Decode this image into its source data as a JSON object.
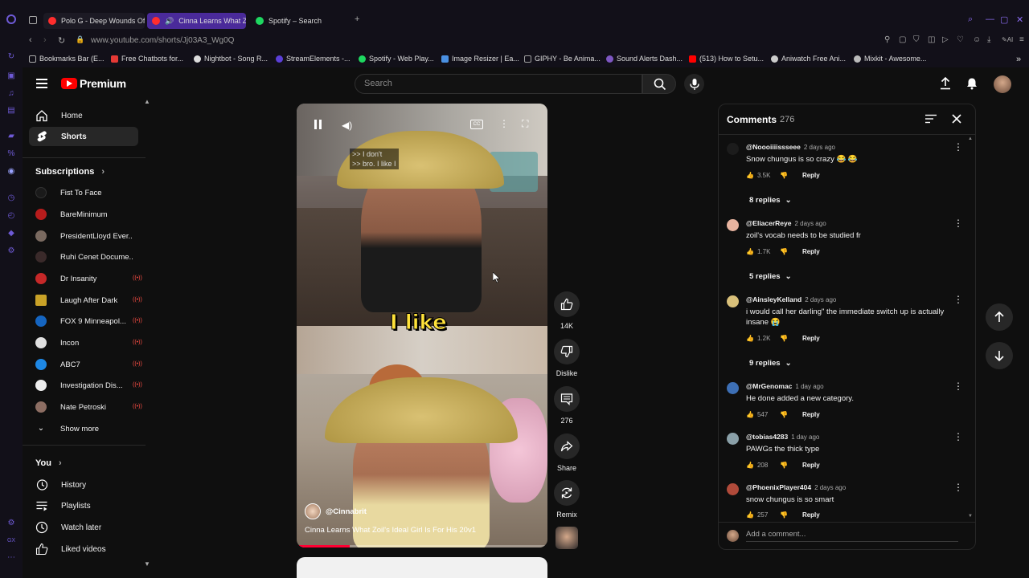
{
  "browser": {
    "tabs": [
      {
        "title": "Polo G - Deep Wounds Off",
        "color": "#ff2d2d"
      },
      {
        "title": "Cinna Learns What Zo",
        "color": "#ff2d2d"
      },
      {
        "title": "Spotify – Search",
        "color": "#1ed760"
      }
    ],
    "url": "www.youtube.com/shorts/Jj03A3_Wg0Q",
    "bookmarks": [
      {
        "label": "Bookmarks Bar (E...",
        "color": "#aaaaaa"
      },
      {
        "label": "Free Chatbots for...",
        "color": "#e53935"
      },
      {
        "label": "Nightbot - Song R...",
        "color": "#dddddd"
      },
      {
        "label": "StreamElements -...",
        "color": "#5b3fd8"
      },
      {
        "label": "Spotify - Web Play...",
        "color": "#1ed760"
      },
      {
        "label": "Image Resizer | Ea...",
        "color": "#4a90e2"
      },
      {
        "label": "GIPHY - Be Anima...",
        "color": "#9e9e9e"
      },
      {
        "label": "Sound Alerts Dash...",
        "color": "#7e57c2"
      },
      {
        "label": "(513) How to Setu...",
        "color": "#ff0000"
      },
      {
        "label": "Aniwatch Free Ani...",
        "color": "#cccccc"
      },
      {
        "label": "Mixkit - Awesome...",
        "color": "#bbbbbb"
      }
    ]
  },
  "header": {
    "logo_text": "Premium",
    "search_placeholder": "Search"
  },
  "nav": {
    "home": "Home",
    "shorts": "Shorts",
    "subscriptions_heading": "Subscriptions",
    "subscriptions": [
      {
        "name": "Fist To Face",
        "color": "#1a1a1a",
        "live": false
      },
      {
        "name": "BareMinimum",
        "color": "#b71c1c",
        "live": false
      },
      {
        "name": "PresidentLloyd Ever...",
        "color": "#7a6a60",
        "live": false
      },
      {
        "name": "Ruhi Cenet Docume...",
        "color": "#3a2a2a",
        "live": false
      },
      {
        "name": "Dr Insanity",
        "color": "#c62828",
        "live": true
      },
      {
        "name": "Laugh After Dark",
        "color": "#c9a227",
        "live": true
      },
      {
        "name": "FOX 9 Minneapol...",
        "color": "#1565c0",
        "live": true
      },
      {
        "name": "Incon",
        "color": "#e0e0e0",
        "live": true
      },
      {
        "name": "ABC7",
        "color": "#1e88e5",
        "live": true
      },
      {
        "name": "Investigation Dis...",
        "color": "#eeeeee",
        "live": true
      },
      {
        "name": "Nate Petroski",
        "color": "#8d6e63",
        "live": true
      }
    ],
    "show_more": "Show more",
    "you_heading": "You",
    "you_items": [
      "History",
      "Playlists",
      "Watch later",
      "Liked videos"
    ]
  },
  "video": {
    "cc_lines": [
      ">> I don't",
      ">> bro. I like I"
    ],
    "caption": "I like",
    "channel": "@Cinnabrit",
    "title": "Cinna Learns What Zoil's Ideal Girl Is For His 20v1",
    "progress": 0.21
  },
  "actions": {
    "likes": "14K",
    "dislike": "Dislike",
    "comments": "276",
    "share": "Share",
    "remix": "Remix"
  },
  "comments": {
    "title": "Comments",
    "count": "276",
    "add_placeholder": "Add a comment...",
    "items": [
      {
        "author": "@Noooiiiissseee",
        "time": "2 days ago",
        "text": "Snow chungus is so crazy 😂 😂",
        "likes": "3.5K",
        "replies": "8 replies",
        "avatar": "#1c1c1c"
      },
      {
        "author": "@EliacerReye",
        "time": "2 days ago",
        "text": "zoil's vocab needs to be studied fr",
        "likes": "1.7K",
        "replies": "5 replies",
        "avatar": "#e8b4a0"
      },
      {
        "author": "@AinsleyKelland",
        "time": "2 days ago",
        "text": "i would call her darling\" the immediate switch up is actually insane 😭",
        "likes": "1.2K",
        "replies": "9 replies",
        "avatar": "#d9c07a"
      },
      {
        "author": "@MrGenomac",
        "time": "1 day ago",
        "text": "He done added a new category.",
        "likes": "547",
        "replies": "",
        "avatar": "#3d6fb5"
      },
      {
        "author": "@tobias4283",
        "time": "1 day ago",
        "text": "PAWGs the thick type",
        "likes": "208",
        "replies": "",
        "avatar": "#8aa0a8"
      },
      {
        "author": "@PhoenixPlayer404",
        "time": "2 days ago",
        "text": "snow chungus is so smart",
        "likes": "257",
        "replies": "",
        "avatar": "#b04a3a"
      }
    ],
    "reply_label": "Reply"
  }
}
